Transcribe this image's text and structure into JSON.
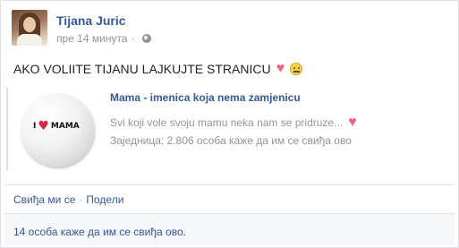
{
  "post": {
    "author_name": "Tijana Juric",
    "timestamp": "пре 14 минута",
    "privacy_icon": "globe-icon",
    "text": "AKO VOLIITE TIJANU LAJKUJTE STRANICU",
    "emoji": [
      "heart-emoji",
      "smile-emoji"
    ]
  },
  "shared_page": {
    "title": "Mama - imenica koja nema zamjenicu",
    "description": "Svi koji vole svoju mamu neka nam se pridruze...",
    "community_line": "Заједница: 2.806 особа каже да им се свиђа ово",
    "thumbnail_text_left": "I",
    "thumbnail_text_right": "MAMA"
  },
  "actions": {
    "like_label": "Свиђа ми се",
    "separator": "·",
    "share_label": "Подели"
  },
  "likes": {
    "summary": "14 особа каже да им се свиђа ово."
  },
  "colors": {
    "link_blue": "#365899",
    "muted_gray": "#90949c",
    "heart_pink": "#f0637e"
  }
}
